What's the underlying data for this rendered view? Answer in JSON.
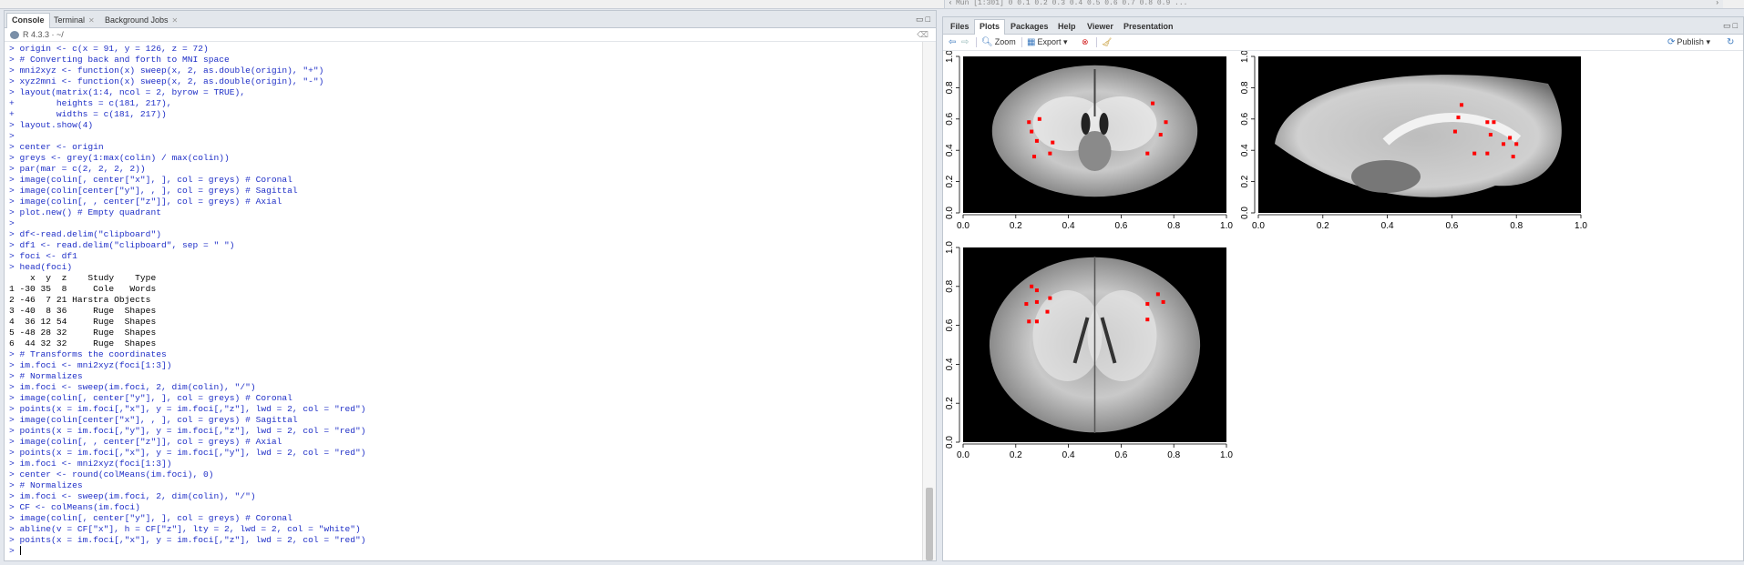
{
  "top_strip": {
    "left_arrow": "‹",
    "text": "Mun [1:301] 0 0.1 0.2 0.3 0.4 0.5 0.6 0.7 0.8 0.9 ...",
    "right_arrow": "›"
  },
  "console_pane": {
    "tabs": [
      {
        "label": "Console"
      },
      {
        "label": "Terminal"
      },
      {
        "label": "Background Jobs"
      }
    ],
    "r_version": "R 4.3.3 · ~/",
    "lines": [
      {
        "kind": "cmd",
        "text": "> origin <- c(x = 91, y = 126, z = 72)"
      },
      {
        "kind": "cmd",
        "text": "> # Converting back and forth to MNI space"
      },
      {
        "kind": "cmd",
        "text": "> mni2xyz <- function(x) sweep(x, 2, as.double(origin), \"+\")"
      },
      {
        "kind": "cmd",
        "text": "> xyz2mni <- function(x) sweep(x, 2, as.double(origin), \"-\")"
      },
      {
        "kind": "cmd",
        "text": "> layout(matrix(1:4, ncol = 2, byrow = TRUE),"
      },
      {
        "kind": "cmd",
        "text": "+        heights = c(181, 217),"
      },
      {
        "kind": "cmd",
        "text": "+        widths = c(181, 217))"
      },
      {
        "kind": "cmd",
        "text": "> layout.show(4)"
      },
      {
        "kind": "cmd",
        "text": ">"
      },
      {
        "kind": "cmd",
        "text": "> center <- origin"
      },
      {
        "kind": "cmd",
        "text": "> greys <- grey(1:max(colin) / max(colin))"
      },
      {
        "kind": "cmd",
        "text": "> par(mar = c(2, 2, 2, 2))"
      },
      {
        "kind": "cmd",
        "text": "> image(colin[, center[\"x\"], ], col = greys) # Coronal"
      },
      {
        "kind": "cmd",
        "text": "> image(colin[center[\"y\"], , ], col = greys) # Sagittal"
      },
      {
        "kind": "cmd",
        "text": "> image(colin[, , center[\"z\"]], col = greys) # Axial"
      },
      {
        "kind": "cmd",
        "text": "> plot.new() # Empty quadrant"
      },
      {
        "kind": "cmd",
        "text": ">"
      },
      {
        "kind": "cmd",
        "text": "> df<-read.delim(\"clipboard\")"
      },
      {
        "kind": "cmd",
        "text": "> df1 <- read.delim(\"clipboard\", sep = \" \")"
      },
      {
        "kind": "cmd",
        "text": "> foci <- df1"
      },
      {
        "kind": "cmd",
        "text": "> head(foci)"
      },
      {
        "kind": "out",
        "text": "    x  y  z    Study    Type"
      },
      {
        "kind": "out",
        "text": "1 -30 35  8     Cole   Words"
      },
      {
        "kind": "out",
        "text": "2 -46  7 21 Harstra Objects"
      },
      {
        "kind": "out",
        "text": "3 -40  8 36     Ruge  Shapes"
      },
      {
        "kind": "out",
        "text": "4  36 12 54     Ruge  Shapes"
      },
      {
        "kind": "out",
        "text": "5 -48 28 32     Ruge  Shapes"
      },
      {
        "kind": "out",
        "text": "6  44 32 32     Ruge  Shapes"
      },
      {
        "kind": "cmd",
        "text": "> # Transforms the coordinates"
      },
      {
        "kind": "cmd",
        "text": "> im.foci <- mni2xyz(foci[1:3])"
      },
      {
        "kind": "cmd",
        "text": "> # Normalizes"
      },
      {
        "kind": "cmd",
        "text": "> im.foci <- sweep(im.foci, 2, dim(colin), \"/\")"
      },
      {
        "kind": "cmd",
        "text": "> image(colin[, center[\"y\"], ], col = greys) # Coronal"
      },
      {
        "kind": "cmd",
        "text": "> points(x = im.foci[,\"x\"], y = im.foci[,\"z\"], lwd = 2, col = \"red\")"
      },
      {
        "kind": "cmd",
        "text": "> image(colin[center[\"x\"], , ], col = greys) # Sagittal"
      },
      {
        "kind": "cmd",
        "text": "> points(x = im.foci[,\"y\"], y = im.foci[,\"z\"], lwd = 2, col = \"red\")"
      },
      {
        "kind": "cmd",
        "text": "> image(colin[, , center[\"z\"]], col = greys) # Axial"
      },
      {
        "kind": "cmd",
        "text": "> points(x = im.foci[,\"x\"], y = im.foci[,\"y\"], lwd = 2, col = \"red\")"
      },
      {
        "kind": "cmd",
        "text": "> im.foci <- mni2xyz(foci[1:3])"
      },
      {
        "kind": "cmd",
        "text": "> center <- round(colMeans(im.foci), 0)"
      },
      {
        "kind": "cmd",
        "text": "> # Normalizes"
      },
      {
        "kind": "cmd",
        "text": "> im.foci <- sweep(im.foci, 2, dim(colin), \"/\")"
      },
      {
        "kind": "cmd",
        "text": "> CF <- colMeans(im.foci)"
      },
      {
        "kind": "cmd",
        "text": "> image(colin[, center[\"y\"], ], col = greys) # Coronal"
      },
      {
        "kind": "cmd",
        "text": "> abline(v = CF[\"x\"], h = CF[\"z\"], lty = 2, lwd = 2, col = \"white\")"
      },
      {
        "kind": "cmd",
        "text": "> points(x = im.foci[,\"x\"], y = im.foci[,\"z\"], lwd = 2, col = \"red\")"
      }
    ],
    "prompt": ">"
  },
  "files_pane": {
    "tabs": [
      {
        "label": "Files"
      },
      {
        "label": "Plots"
      },
      {
        "label": "Packages"
      },
      {
        "label": "Help"
      },
      {
        "label": "Viewer"
      },
      {
        "label": "Presentation"
      }
    ],
    "active_tab": "Plots",
    "toolbar": {
      "zoom": "Zoom",
      "export": "Export",
      "publish": "Publish"
    },
    "colors": {
      "marker": "#ff0000",
      "background": "#000000"
    }
  },
  "chart_data": [
    {
      "type": "scatter",
      "name": "coronal",
      "xlim": [
        0,
        1
      ],
      "ylim": [
        0,
        1
      ],
      "x_ticks": [
        "0.0",
        "0.2",
        "0.4",
        "0.6",
        "0.8",
        "1.0"
      ],
      "y_ticks": [
        "0.0",
        "0.2",
        "0.4",
        "0.6",
        "0.8",
        "1.0"
      ],
      "points": [
        [
          0.25,
          0.58
        ],
        [
          0.29,
          0.6
        ],
        [
          0.26,
          0.52
        ],
        [
          0.28,
          0.46
        ],
        [
          0.34,
          0.45
        ],
        [
          0.27,
          0.36
        ],
        [
          0.33,
          0.38
        ],
        [
          0.72,
          0.7
        ],
        [
          0.77,
          0.58
        ],
        [
          0.75,
          0.5
        ],
        [
          0.7,
          0.38
        ]
      ]
    },
    {
      "type": "scatter",
      "name": "sagittal",
      "xlim": [
        0,
        1
      ],
      "ylim": [
        0,
        1
      ],
      "x_ticks": [
        "0.0",
        "0.2",
        "0.4",
        "0.6",
        "0.8",
        "1.0"
      ],
      "y_ticks": [
        "0.0",
        "0.2",
        "0.4",
        "0.6",
        "0.8",
        "1.0"
      ],
      "points": [
        [
          0.63,
          0.69
        ],
        [
          0.62,
          0.61
        ],
        [
          0.61,
          0.52
        ],
        [
          0.71,
          0.58
        ],
        [
          0.73,
          0.58
        ],
        [
          0.72,
          0.5
        ],
        [
          0.76,
          0.44
        ],
        [
          0.78,
          0.48
        ],
        [
          0.8,
          0.44
        ],
        [
          0.67,
          0.38
        ],
        [
          0.71,
          0.38
        ],
        [
          0.79,
          0.36
        ]
      ]
    },
    {
      "type": "scatter",
      "name": "axial",
      "xlim": [
        0,
        1
      ],
      "ylim": [
        0,
        1
      ],
      "x_ticks": [
        "0.0",
        "0.2",
        "0.4",
        "0.6",
        "0.8",
        "1.0"
      ],
      "y_ticks": [
        "0.0",
        "0.2",
        "0.4",
        "0.6",
        "0.8",
        "1.0"
      ],
      "points": [
        [
          0.26,
          0.8
        ],
        [
          0.28,
          0.78
        ],
        [
          0.24,
          0.71
        ],
        [
          0.28,
          0.72
        ],
        [
          0.33,
          0.74
        ],
        [
          0.32,
          0.67
        ],
        [
          0.25,
          0.62
        ],
        [
          0.28,
          0.62
        ],
        [
          0.7,
          0.71
        ],
        [
          0.74,
          0.76
        ],
        [
          0.76,
          0.72
        ],
        [
          0.7,
          0.63
        ]
      ]
    }
  ]
}
